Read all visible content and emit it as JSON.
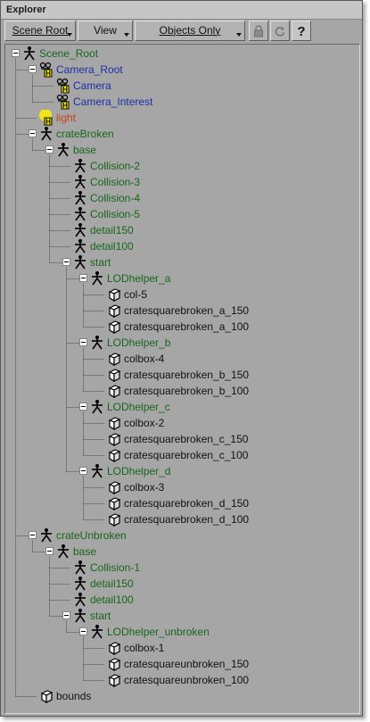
{
  "window": {
    "title": "Explorer"
  },
  "toolbar": {
    "scene_root": "Scene Root",
    "view": "View",
    "objects_only": "Objects Only"
  },
  "colors": {
    "panel_bg": "#a6a6a6",
    "null_green": "#17661a",
    "camera_blue": "#1d2fa8",
    "light_orange": "#c84316",
    "mesh_black": "#111111",
    "light_highlight": "#ffef00"
  },
  "tree": [
    {
      "label": "Scene_Root",
      "depth": 0,
      "icon": "null-icon",
      "color": "green",
      "toggle": true
    },
    {
      "label": "Camera_Root",
      "depth": 1,
      "icon": "camera-root-icon",
      "color": "blue",
      "toggle": true
    },
    {
      "label": "Camera",
      "depth": 2,
      "icon": "camera-icon",
      "color": "blue",
      "toggle": false
    },
    {
      "label": "Camera_Interest",
      "depth": 2,
      "icon": "camera-interest-icon",
      "color": "blue",
      "toggle": false
    },
    {
      "label": "light",
      "depth": 1,
      "icon": "light-icon",
      "color": "orange",
      "toggle": false
    },
    {
      "label": "crateBroken",
      "depth": 1,
      "icon": "null-icon",
      "color": "green",
      "toggle": true
    },
    {
      "label": "base",
      "depth": 2,
      "icon": "null-icon",
      "color": "green",
      "toggle": true
    },
    {
      "label": "Collision-2",
      "depth": 3,
      "icon": "null-icon",
      "color": "green",
      "toggle": false
    },
    {
      "label": "Collision-3",
      "depth": 3,
      "icon": "null-icon",
      "color": "green",
      "toggle": false
    },
    {
      "label": "Collision-4",
      "depth": 3,
      "icon": "null-icon",
      "color": "green",
      "toggle": false
    },
    {
      "label": "Collision-5",
      "depth": 3,
      "icon": "null-icon",
      "color": "green",
      "toggle": false
    },
    {
      "label": "detail150",
      "depth": 3,
      "icon": "null-icon",
      "color": "green",
      "toggle": false
    },
    {
      "label": "detail100",
      "depth": 3,
      "icon": "null-icon",
      "color": "green",
      "toggle": false
    },
    {
      "label": "start",
      "depth": 3,
      "icon": "null-icon",
      "color": "green",
      "toggle": true
    },
    {
      "label": "LODhelper_a",
      "depth": 4,
      "icon": "null-icon",
      "color": "green",
      "toggle": true
    },
    {
      "label": "col-5",
      "depth": 5,
      "icon": "polymesh-icon",
      "color": "black",
      "toggle": false
    },
    {
      "label": "cratesquarebroken_a_150",
      "depth": 5,
      "icon": "polymesh-icon",
      "color": "black",
      "toggle": false
    },
    {
      "label": "cratesquarebroken_a_100",
      "depth": 5,
      "icon": "polymesh-icon",
      "color": "black",
      "toggle": false
    },
    {
      "label": "LODhelper_b",
      "depth": 4,
      "icon": "null-icon",
      "color": "green",
      "toggle": true
    },
    {
      "label": "colbox-4",
      "depth": 5,
      "icon": "polymesh-icon",
      "color": "black",
      "toggle": false
    },
    {
      "label": "cratesquarebroken_b_150",
      "depth": 5,
      "icon": "polymesh-icon",
      "color": "black",
      "toggle": false
    },
    {
      "label": "cratesquarebroken_b_100",
      "depth": 5,
      "icon": "polymesh-icon",
      "color": "black",
      "toggle": false
    },
    {
      "label": "LODhelper_c",
      "depth": 4,
      "icon": "null-icon",
      "color": "green",
      "toggle": true
    },
    {
      "label": "colbox-2",
      "depth": 5,
      "icon": "polymesh-icon",
      "color": "black",
      "toggle": false
    },
    {
      "label": "cratesquarebroken_c_150",
      "depth": 5,
      "icon": "polymesh-icon",
      "color": "black",
      "toggle": false
    },
    {
      "label": "cratesquarebroken_c_100",
      "depth": 5,
      "icon": "polymesh-icon",
      "color": "black",
      "toggle": false
    },
    {
      "label": "LODhelper_d",
      "depth": 4,
      "icon": "null-icon",
      "color": "green",
      "toggle": true
    },
    {
      "label": "colbox-3",
      "depth": 5,
      "icon": "polymesh-icon",
      "color": "black",
      "toggle": false
    },
    {
      "label": "cratesquarebroken_d_150",
      "depth": 5,
      "icon": "polymesh-icon",
      "color": "black",
      "toggle": false
    },
    {
      "label": "cratesquarebroken_d_100",
      "depth": 5,
      "icon": "polymesh-icon",
      "color": "black",
      "toggle": false
    },
    {
      "label": "crateUnbroken",
      "depth": 1,
      "icon": "null-icon",
      "color": "green",
      "toggle": true
    },
    {
      "label": "base",
      "depth": 2,
      "icon": "null-icon",
      "color": "green",
      "toggle": true
    },
    {
      "label": "Collision-1",
      "depth": 3,
      "icon": "null-icon",
      "color": "green",
      "toggle": false
    },
    {
      "label": "detail150",
      "depth": 3,
      "icon": "null-icon",
      "color": "green",
      "toggle": false
    },
    {
      "label": "detail100",
      "depth": 3,
      "icon": "null-icon",
      "color": "green",
      "toggle": false
    },
    {
      "label": "start",
      "depth": 3,
      "icon": "null-icon",
      "color": "green",
      "toggle": true
    },
    {
      "label": "LODhelper_unbroken",
      "depth": 4,
      "icon": "null-icon",
      "color": "green",
      "toggle": true
    },
    {
      "label": "colbox-1",
      "depth": 5,
      "icon": "polymesh-icon",
      "color": "black",
      "toggle": false
    },
    {
      "label": "cratesquareunbroken_150",
      "depth": 5,
      "icon": "polymesh-icon",
      "color": "black",
      "toggle": false
    },
    {
      "label": "cratesquareunbroken_100",
      "depth": 5,
      "icon": "polymesh-icon",
      "color": "black",
      "toggle": false
    },
    {
      "label": "bounds",
      "depth": 1,
      "icon": "polymesh-icon",
      "color": "black",
      "toggle": false
    }
  ]
}
